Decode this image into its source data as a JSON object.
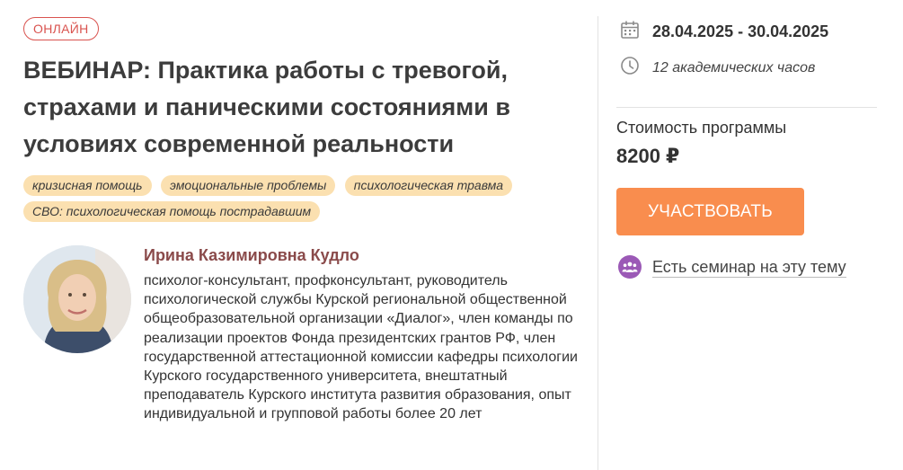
{
  "event": {
    "format_badge": "ОНЛАЙН",
    "title": "ВЕБИНАР: Практика работы с тревогой, страхами и паническими состояниями в условиях современной реальности",
    "tags": [
      "кризисная помощь",
      "эмоциональные проблемы",
      "психологическая травма",
      "СВО: психологическая помощь пострадавшим"
    ]
  },
  "author": {
    "name": "Ирина Казимировна Кудло",
    "bio": "психолог-консультант, профконсультант, руководитель психологической службы Курской региональной общественной общеобразовательной организации «Диалог», член команды по реализации проектов Фонда президентских грантов РФ, член государственной аттестационной комиссии кафедры психологии Курского государственного университета, внештатный преподаватель Курского института развития образования, опыт индивидуальной и групповой работы более 20 лет"
  },
  "sidebar": {
    "dates": "28.04.2025 - 30.04.2025",
    "hours": "12 академических часов",
    "price_label": "Стоимость программы",
    "price": "8200 ₽",
    "cta_label": "УЧАСТВОВАТЬ",
    "seminar_link": "Есть семинар на эту тему",
    "icons": {
      "date": "calendar-icon",
      "hours": "clock-icon",
      "seminar": "group-icon"
    }
  },
  "colors": {
    "accent_orange": "#f98d4e",
    "badge_red": "#d9534f",
    "tag_bg": "#fbe0b0",
    "author_name": "#8a4a4a",
    "seminar_icon_bg": "#9b59b6"
  }
}
